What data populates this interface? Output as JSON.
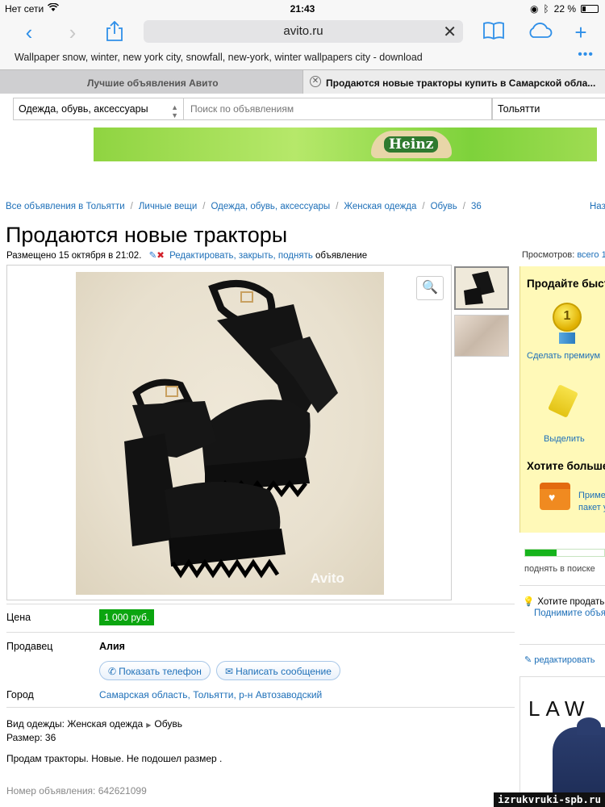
{
  "status_bar": {
    "carrier": "Нет сети",
    "time": "21:43",
    "battery": "22 %"
  },
  "browser": {
    "url": "avito.ru",
    "bookmark": "Wallpaper snow, winter, new york city, snowfall, new-york, winter wallpapers city - download",
    "tabs": [
      {
        "label": "Лучшие объявления Авито",
        "active": false
      },
      {
        "label": "Продаются новые тракторы купить в Самарской обла...",
        "active": true
      }
    ]
  },
  "search": {
    "category": "Одежда, обувь, аксессуары",
    "placeholder": "Поиск по объявлениям",
    "city": "Тольятти"
  },
  "banner": {
    "brand": "Heinz"
  },
  "breadcrumbs": [
    "Все объявления в Тольятти",
    "Личные вещи",
    "Одежда, обувь, аксессуары",
    "Женская одежда",
    "Обувь",
    "36"
  ],
  "breadcrumb_next": "Наз",
  "listing": {
    "title": "Продаются новые тракторы",
    "posted": "Размещено 15 октября в 21:02.",
    "edit_link": "Редактировать, закрыть, поднять",
    "edit_suffix": " объявление",
    "watermark": "Avito",
    "price_label": "Цена",
    "price": "1 000 руб.",
    "seller_label": "Продавец",
    "seller": "Алия",
    "show_phone": "Показать телефон",
    "write_message": "Написать сообщение",
    "city_label": "Город",
    "city": "Самарская область, Тольятти, р-н Автозаводский",
    "clothing_type_label": "Вид одежды: Женская одежда",
    "clothing_type_value": "Обувь",
    "size": "Размер: 36",
    "description": "Продам тракторы. Новые. Не подошел размер .",
    "ad_number": "Номер объявления: 642621099"
  },
  "sidebar": {
    "views_label": "Просмотров: ",
    "views_link": "всего 1",
    "promo_title": "Продайте быст",
    "premium_link": "Сделать премиум",
    "highlight_link": "Выделить",
    "more_title": "Хотите больше",
    "package_line1": "Приме",
    "package_line2": "пакет у",
    "search_progress": 0.4,
    "search_label": "поднять в поиске",
    "sell_tip": "Хотите продать б",
    "sell_link": "Поднимите объяв",
    "edit_link": "редактировать",
    "ad_brand": "LAW"
  },
  "site_watermark": "izrukvruki-spb.ru"
}
